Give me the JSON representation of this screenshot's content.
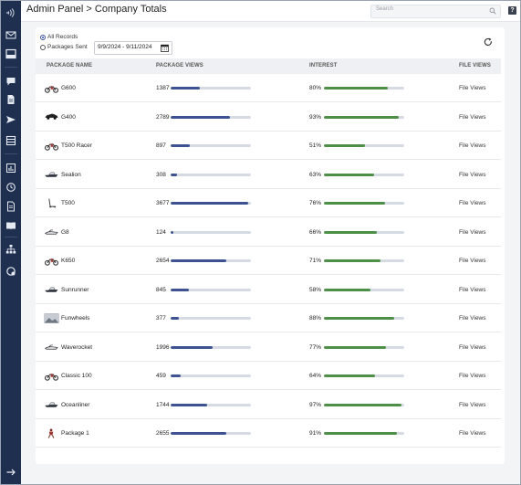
{
  "header": {
    "title": "Admin Panel > Company Totals",
    "search_placeholder": "Search",
    "help_label": "?"
  },
  "sidebar": {
    "icons": [
      "logo-icon",
      "mail-icon",
      "inbox-icon",
      "chat-icon",
      "document-icon",
      "send-icon",
      "stack-icon",
      "report-icon",
      "history-icon",
      "file-icon",
      "book-icon",
      "org-chart-icon",
      "settings-icon",
      "expand-arrow-icon"
    ]
  },
  "filters": {
    "all_records_label": "All Records",
    "packages_sent_label": "Packages Sent",
    "selected": "All Records",
    "date_range": "9/9/2024 - 9/11/2024"
  },
  "table": {
    "columns": [
      "PACKAGE NAME",
      "PACKAGE VIEWS",
      "INTEREST",
      "FILE VIEWS"
    ],
    "max_views": 3800,
    "rows": [
      {
        "name": "G600",
        "icon": "motorcycle-icon",
        "views": 1387,
        "interest": 80,
        "interest_label": "80%",
        "file_views": "File Views"
      },
      {
        "name": "G400",
        "icon": "car-icon",
        "views": 2789,
        "interest": 93,
        "interest_label": "93%",
        "file_views": "File Views"
      },
      {
        "name": "T500 Racer",
        "icon": "motorcycle-icon",
        "views": 897,
        "interest": 51,
        "interest_label": "51%",
        "file_views": "File Views"
      },
      {
        "name": "Sealion",
        "icon": "boat-icon",
        "views": 308,
        "interest": 63,
        "interest_label": "63%",
        "file_views": "File Views"
      },
      {
        "name": "T500",
        "icon": "scooter-icon",
        "views": 3677,
        "interest": 76,
        "interest_label": "76%",
        "file_views": "File Views"
      },
      {
        "name": "G8",
        "icon": "jetski-icon",
        "views": 124,
        "interest": 66,
        "interest_label": "66%",
        "file_views": "File Views"
      },
      {
        "name": "K650",
        "icon": "motorcycle-icon",
        "views": 2654,
        "interest": 71,
        "interest_label": "71%",
        "file_views": "File Views"
      },
      {
        "name": "Sunrunner",
        "icon": "boat-icon",
        "views": 845,
        "interest": 58,
        "interest_label": "58%",
        "file_views": "File Views"
      },
      {
        "name": "Funwheels",
        "icon": "photo-icon",
        "views": 377,
        "interest": 88,
        "interest_label": "88%",
        "file_views": "File Views"
      },
      {
        "name": "Waverocket",
        "icon": "jetski-icon",
        "views": 1996,
        "interest": 77,
        "interest_label": "77%",
        "file_views": "File Views"
      },
      {
        "name": "Classic 100",
        "icon": "motorcycle-icon",
        "views": 459,
        "interest": 64,
        "interest_label": "64%",
        "file_views": "File Views"
      },
      {
        "name": "Oceanliner",
        "icon": "boat-icon",
        "views": 1744,
        "interest": 97,
        "interest_label": "97%",
        "file_views": "File Views"
      },
      {
        "name": "Package 1",
        "icon": "figure-icon",
        "views": 2655,
        "interest": 91,
        "interest_label": "91%",
        "file_views": "File Views"
      }
    ]
  },
  "colors": {
    "sidebar": "#1f2f4f",
    "views_bar": "#3d5290",
    "interest_bar": "#4e8f47",
    "track": "#d6dbe3"
  }
}
